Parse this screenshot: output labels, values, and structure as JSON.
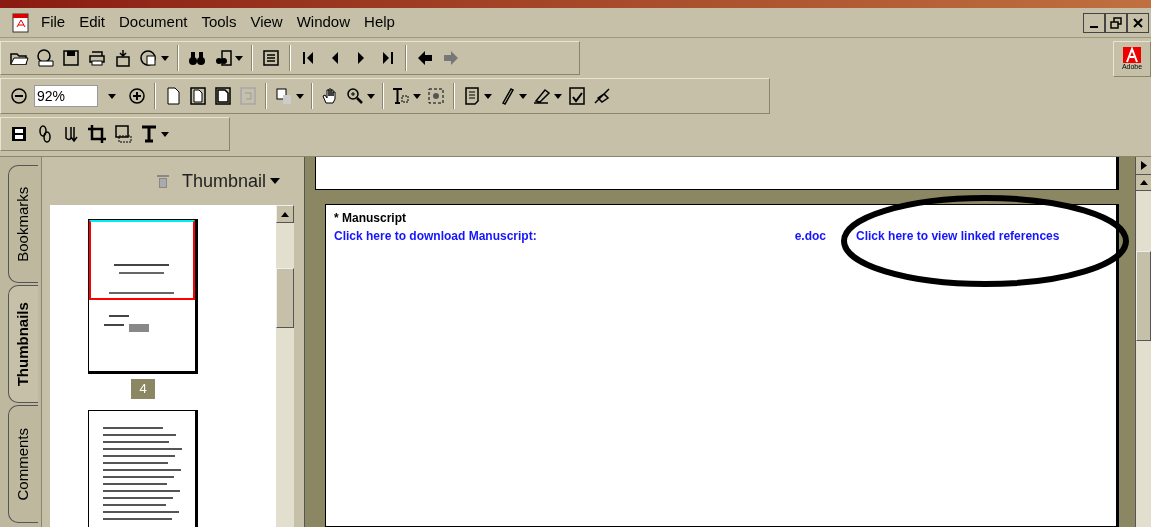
{
  "menu": [
    {
      "label": "File"
    },
    {
      "label": "Edit"
    },
    {
      "label": "Document"
    },
    {
      "label": "Tools"
    },
    {
      "label": "View"
    },
    {
      "label": "Window"
    },
    {
      "label": "Help"
    }
  ],
  "zoom": {
    "value": "92%"
  },
  "logo_text": "Adobe",
  "side_tabs": [
    {
      "label": "Bookmarks",
      "selected": false
    },
    {
      "label": "Thumbnails",
      "selected": true
    },
    {
      "label": "Comments",
      "selected": false
    }
  ],
  "panel": {
    "title": "Thumbnail"
  },
  "thumbnails": [
    {
      "label": "4",
      "selected": true
    },
    {
      "selected": false
    }
  ],
  "document": {
    "heading": "* Manuscript",
    "download_link": "Click here to download Manuscript:",
    "file_fragment": "e.doc",
    "references_link": "Click here to view linked references"
  }
}
